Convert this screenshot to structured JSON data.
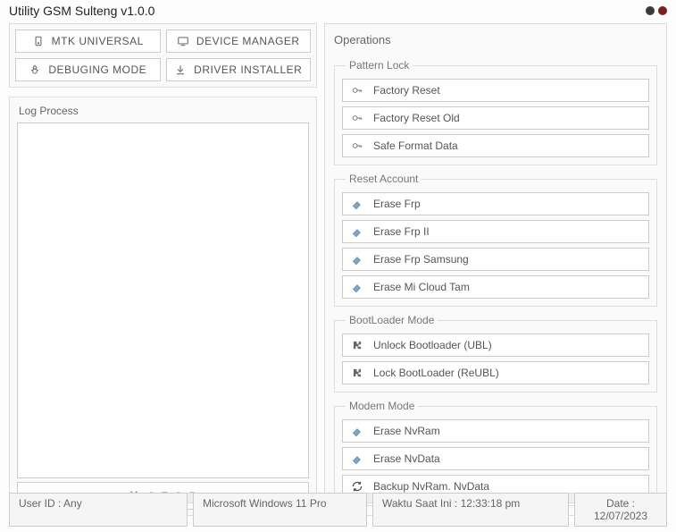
{
  "app": {
    "title": "Utility GSM Sulteng v1.0.0"
  },
  "tabs": {
    "mtk": "MTK   UNIVERSAL",
    "device_manager": "DEVICE  MANAGER",
    "debug": "DEBUGING MODE",
    "driver": "DRIVER INSTALLER"
  },
  "log": {
    "label": "Log Process",
    "stop": "S T O P"
  },
  "ops": {
    "title": "Operations",
    "pattern_lock": {
      "legend": "Pattern Lock",
      "factory_reset": "Factory Reset",
      "factory_reset_old": "Factory Reset Old",
      "safe_format": "Safe Format Data"
    },
    "reset_account": {
      "legend": "Reset Account",
      "erase_frp": "Erase Frp",
      "erase_frp2": "Erase Frp II",
      "erase_frp_samsung": "Erase Frp Samsung",
      "erase_mi_cloud": "Erase Mi Cloud Tam"
    },
    "bootloader": {
      "legend": "BootLoader Mode",
      "unlock": "Unlock Bootloader (UBL)",
      "lock": "Lock BootLoader (ReUBL)"
    },
    "modem": {
      "legend": "Modem Mode",
      "erase_nvram": "Erase NvRam",
      "erase_nvdata": "Erase NvData",
      "backup": "Backup NvRam. NvData"
    }
  },
  "status": {
    "user": "User ID : Any",
    "os": "Microsoft Windows 11 Pro",
    "time": "Waktu Saat Ini : 12:33:18 pm",
    "date": "Date :  12/07/2023"
  }
}
